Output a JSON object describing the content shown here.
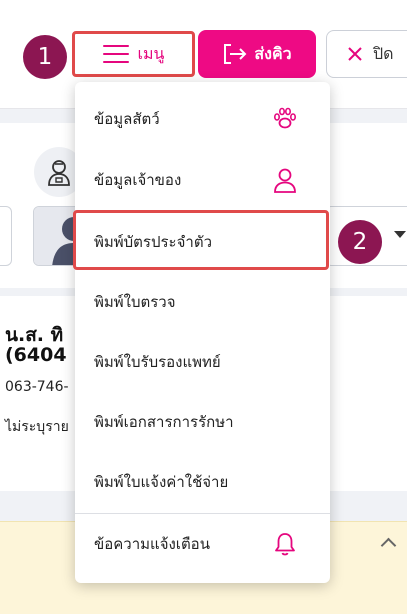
{
  "header": {
    "step1": "1",
    "menu_label": "เมนู",
    "send_label": "ส่งคิว",
    "close_label": "ปิด"
  },
  "owner": {
    "name": "น.ส. ทิ",
    "code": "(6404",
    "phone": "063-746-",
    "address": "ไม่ระบุราย"
  },
  "menu": {
    "items": [
      {
        "label": "ข้อมูลสัตว์",
        "icon": "paw-icon"
      },
      {
        "label": "ข้อมูลเจ้าของ",
        "icon": "user-icon"
      },
      {
        "label": "พิมพ์บัตรประจำตัว"
      },
      {
        "label": "พิมพ์ใบตรวจ"
      },
      {
        "label": "พิมพ์ใบรับรองแพทย์"
      },
      {
        "label": "พิมพ์เอกสารการรักษา"
      },
      {
        "label": "พิมพ์ใบแจ้งค่าใช้จ่าย"
      },
      {
        "label": "ข้อความแจ้งเตือน",
        "icon": "bell-icon"
      }
    ],
    "step2": "2"
  },
  "colors": {
    "accent": "#ee0a84",
    "step_badge": "#8c1652",
    "highlight_border": "#e04a4a",
    "notice_bg": "#fdf5d9"
  }
}
